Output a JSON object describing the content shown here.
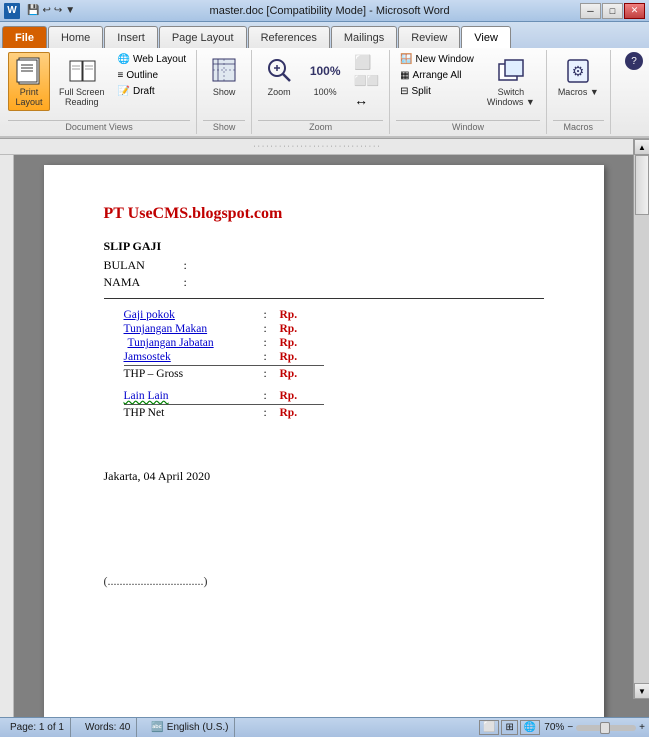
{
  "titleBar": {
    "title": "master.doc [Compatibility Mode] - Microsoft Word",
    "minimizeLabel": "─",
    "maximizeLabel": "□",
    "closeLabel": "✕"
  },
  "tabs": [
    {
      "id": "file",
      "label": "File",
      "type": "file"
    },
    {
      "id": "home",
      "label": "Home",
      "type": "regular"
    },
    {
      "id": "insert",
      "label": "Insert",
      "type": "regular"
    },
    {
      "id": "pagelayout",
      "label": "Page Layout",
      "type": "regular"
    },
    {
      "id": "references",
      "label": "References",
      "type": "regular"
    },
    {
      "id": "mailings",
      "label": "Mailings",
      "type": "regular"
    },
    {
      "id": "review",
      "label": "Review",
      "type": "regular"
    },
    {
      "id": "view",
      "label": "View",
      "type": "active"
    }
  ],
  "ribbon": {
    "groups": [
      {
        "label": "Document Views",
        "buttons": [
          {
            "id": "print-layout",
            "label": "Print\nLayout",
            "icon": "📄",
            "type": "big",
            "active": true
          },
          {
            "id": "full-screen",
            "label": "Full Screen\nReading",
            "icon": "📖",
            "type": "big"
          },
          {
            "id": "web-layout",
            "label": "Web Layout",
            "icon": "🌐",
            "type": "small"
          },
          {
            "id": "outline",
            "label": "Outline",
            "icon": "≡",
            "type": "small"
          },
          {
            "id": "draft",
            "label": "Draft",
            "icon": "📝",
            "type": "small"
          }
        ]
      },
      {
        "label": "Show",
        "buttons": [
          {
            "id": "show",
            "label": "Show",
            "icon": "👁",
            "type": "big"
          }
        ]
      },
      {
        "label": "Zoom",
        "buttons": [
          {
            "id": "zoom",
            "label": "Zoom",
            "icon": "🔍",
            "type": "big"
          },
          {
            "id": "zoom-100",
            "label": "100%",
            "icon": "📊",
            "type": "big"
          },
          {
            "id": "one-page",
            "label": "",
            "icon": "⬜",
            "type": "big"
          },
          {
            "id": "two-page",
            "label": "",
            "icon": "⬜⬜",
            "type": "big"
          },
          {
            "id": "page-width",
            "label": "",
            "icon": "↔",
            "type": "big"
          }
        ]
      },
      {
        "label": "Window",
        "buttons": [
          {
            "id": "new-window",
            "label": "New Window",
            "icon": "🪟",
            "type": "small"
          },
          {
            "id": "arrange-all",
            "label": "Arrange All",
            "icon": "▦",
            "type": "small"
          },
          {
            "id": "split",
            "label": "Split",
            "icon": "⊟",
            "type": "small"
          },
          {
            "id": "switch-windows",
            "label": "Switch\nWindows",
            "icon": "🔲",
            "type": "big"
          }
        ]
      },
      {
        "label": "Macros",
        "buttons": [
          {
            "id": "macros",
            "label": "Macros",
            "icon": "⚙",
            "type": "big"
          }
        ]
      }
    ]
  },
  "document": {
    "companyTitle": "PT UseCMS.blogspot.com",
    "slipGajiLabel": "SLIP GAJI",
    "bulanLabel": "BULAN",
    "namaLabel": "NAMA",
    "colon": ":",
    "salaryItems": [
      {
        "label": "Gaji pokok",
        "prefix": ": Rp.",
        "colored": true
      },
      {
        "label": "Tunjangan Makan",
        "prefix": ": Rp.",
        "colored": true
      },
      {
        "label": "Tunjangan Jabatan",
        "prefix": ": Rp.",
        "colored": true
      },
      {
        "label": "Jamsostek",
        "prefix": ": Rp.",
        "colored": true
      },
      {
        "label": "THP – Gross",
        "prefix": ": Rp.",
        "colored": false
      },
      {
        "label": "Lain Lain",
        "prefix": ": Rp.",
        "colored": true,
        "wavy": true
      },
      {
        "label": "THP Net",
        "prefix": ": Rp.",
        "colored": false
      }
    ],
    "dateText": "Jakarta, 04 April 2020",
    "signatureLine": "(................................)"
  },
  "statusBar": {
    "page": "Page: 1 of 1",
    "words": "Words: 40",
    "language": "English (U.S.)",
    "zoom": "70%"
  }
}
